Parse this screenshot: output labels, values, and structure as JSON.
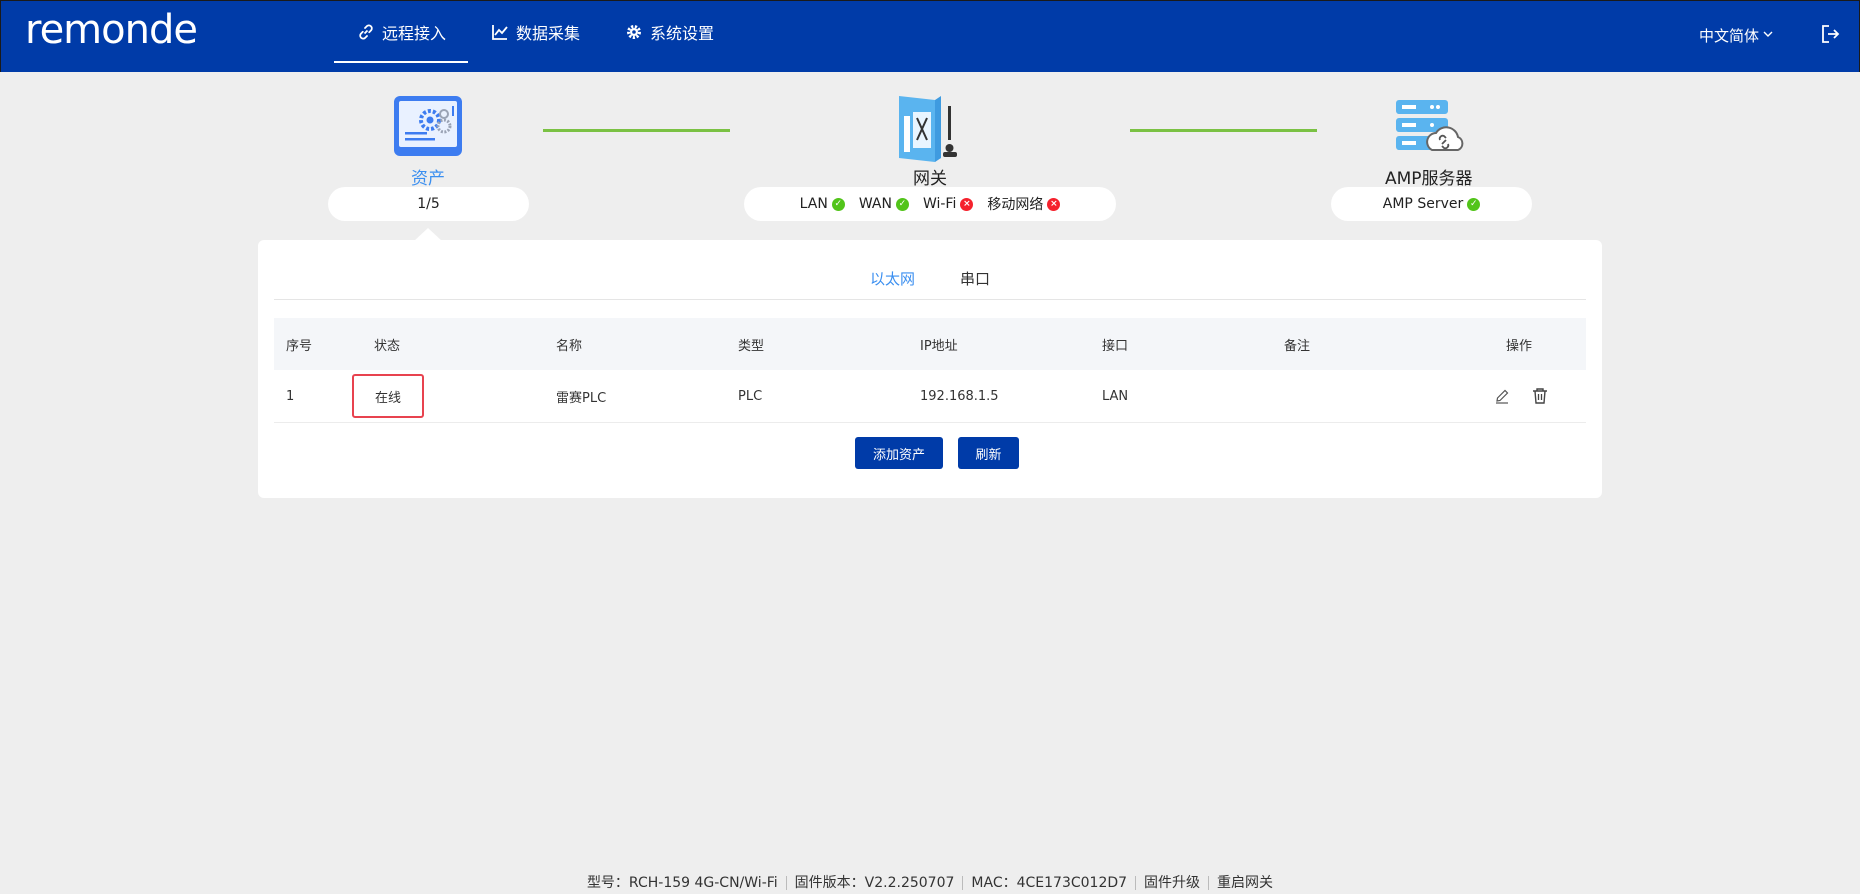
{
  "header": {
    "logo_text": "remonde",
    "nav": [
      {
        "label": "远程接入",
        "icon": "link-icon",
        "active": true
      },
      {
        "label": "数据采集",
        "icon": "chart-icon",
        "active": false
      },
      {
        "label": "系统设置",
        "icon": "gear-icon",
        "active": false
      }
    ],
    "language": "中文简体",
    "logout_icon": "logout-icon"
  },
  "topology": {
    "asset": {
      "label": "资产",
      "count": "1/5"
    },
    "gateway": {
      "label": "网关",
      "statuses": [
        {
          "name": "LAN",
          "ok": true
        },
        {
          "name": "WAN",
          "ok": true
        },
        {
          "name": "Wi-Fi",
          "ok": false
        },
        {
          "name": "移动网络",
          "ok": false
        }
      ]
    },
    "server": {
      "label": "AMP服务器",
      "status_name": "AMP Server",
      "ok": true
    },
    "colors": {
      "link": "#7ac143",
      "ok": "#52c41a",
      "err": "#f5222d",
      "accent": "#003ba8",
      "active_tab": "#3b8ff0"
    }
  },
  "tabs": [
    {
      "label": "以太网",
      "active": true
    },
    {
      "label": "串口",
      "active": false
    }
  ],
  "table": {
    "headers": [
      "序号",
      "状态",
      "名称",
      "类型",
      "IP地址",
      "接口",
      "备注",
      "操作"
    ],
    "rows": [
      {
        "index": "1",
        "status": "在线",
        "name": "雷赛PLC",
        "type": "PLC",
        "ip": "192.168.1.5",
        "interface": "LAN",
        "note": ""
      }
    ]
  },
  "buttons": {
    "add": "添加资产",
    "refresh": "刷新"
  },
  "footer": {
    "model": "型号：RCH-159  4G-CN/Wi-Fi",
    "firmware": "固件版本：V2.2.250707",
    "mac": "MAC：4CE173C012D7",
    "upgrade": "固件升级",
    "reboot": "重启网关"
  }
}
